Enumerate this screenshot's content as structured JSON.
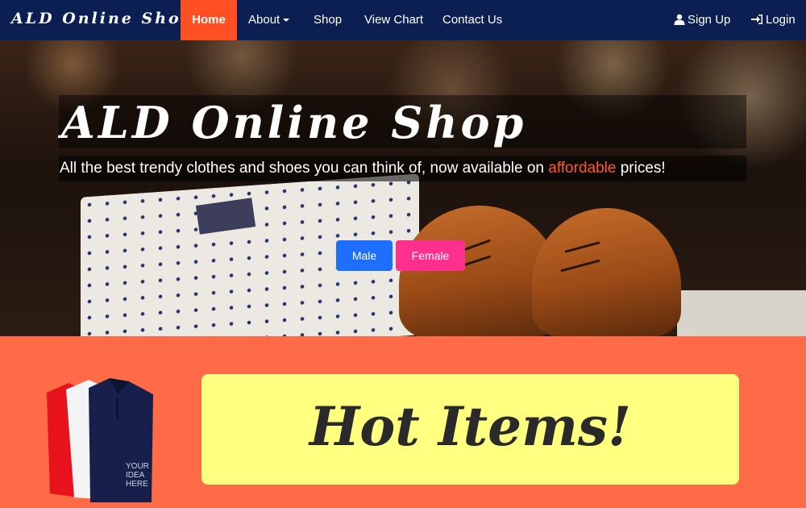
{
  "navbar": {
    "brand": "ALD Online Shop",
    "items": [
      {
        "label": "Home",
        "active": true
      },
      {
        "label": "About",
        "dropdown": true
      },
      {
        "label": "Shop"
      },
      {
        "label": "View Chart"
      },
      {
        "label": "Contact Us"
      }
    ],
    "signup": {
      "label": "Sign Up",
      "icon": "user-icon"
    },
    "login": {
      "label": "Login",
      "icon": "login-icon"
    }
  },
  "hero": {
    "title": "ALD Online Shop",
    "subtitle_before": "All the best trendy clothes and shoes you can think of, now available on ",
    "subtitle_accent": "affordable",
    "subtitle_after": " prices!",
    "buttons": {
      "male": "Male",
      "female": "Female"
    }
  },
  "hot_items": {
    "heading": "Hot Items!",
    "shirt_print": {
      "line1": "YOUR",
      "line2": "IDEA",
      "line3": "HERE"
    }
  },
  "colors": {
    "navbar_bg": "#0b1f52",
    "active_nav": "#ff4f23",
    "accent_text": "#ff5a2e",
    "male_button": "#1e6fff",
    "female_button": "#ff2f8e",
    "section_bg": "#ff6b47",
    "hot_box_bg": "#ffff80"
  }
}
